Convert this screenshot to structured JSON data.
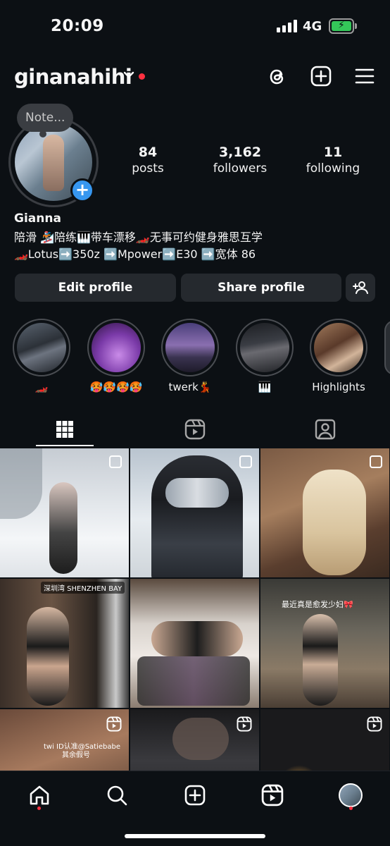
{
  "status_bar": {
    "time": "20:09",
    "network": "4G"
  },
  "header": {
    "username": "ginanahihi"
  },
  "profile": {
    "note": "Note...",
    "name": "Gianna",
    "bio_line1": "陪滑 🏂陪练🎹带车漂移🏎️无事可约健身雅思互学",
    "bio_line2": "🏎️Lotus➡️350z ➡️Mpower➡️E30 ➡️宽体 86",
    "stats": [
      {
        "value": "84",
        "label": "posts"
      },
      {
        "value": "3,162",
        "label": "followers"
      },
      {
        "value": "11",
        "label": "following"
      }
    ]
  },
  "buttons": {
    "edit": "Edit profile",
    "share": "Share profile"
  },
  "highlights": [
    {
      "label": "🏎️"
    },
    {
      "label": "🥵🥵🥵🥵"
    },
    {
      "label": "twerk💃"
    },
    {
      "label": "🎹"
    },
    {
      "label": "Highlights"
    }
  ],
  "grid_overlays": {
    "post4_location": "深圳湾 SHENZHEN BAY",
    "post6_caption": "最近真是愈发少妇🎀",
    "post7_caption_line1": "twi ID认准@Satiebabe",
    "post7_caption_line2": "其余假号"
  },
  "colors": {
    "background": "#0c1014",
    "button": "#25292e",
    "accent_blue": "#3797f0",
    "notification_red": "#ff3040",
    "battery_green": "#34c759"
  }
}
